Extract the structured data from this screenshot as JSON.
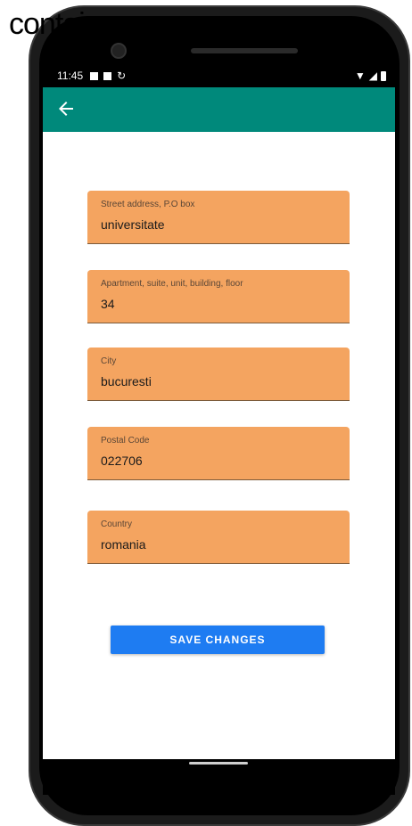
{
  "overlay_text": "container",
  "status_bar": {
    "time": "11:45"
  },
  "app_bar": {
    "back_icon": "arrow-left-icon",
    "color": "#00897b"
  },
  "form": {
    "field_color": "#f4a460",
    "fields": [
      {
        "label": "Street address, P.O box",
        "value": "universitate"
      },
      {
        "label": "Apartment, suite, unit, building, floor",
        "value": "34"
      },
      {
        "label": "City",
        "value": "bucuresti"
      },
      {
        "label": "Postal Code",
        "value": "022706"
      },
      {
        "label": "Country",
        "value": "romania"
      }
    ],
    "save_label": "SAVE CHANGES",
    "save_color": "#1e7cf2"
  }
}
